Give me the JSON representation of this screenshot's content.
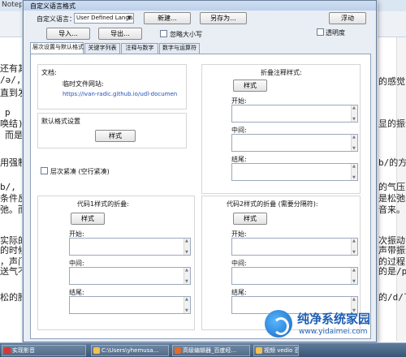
{
  "background": {
    "title": "Notepad",
    "lines_left": [
      "还有其",
      "/ə/,",
      "直到发",
      "p",
      "唤结)",
      "而是",
      "用强制",
      "b/, 就",
      "条件反",
      "弛。而",
      "实际的",
      "的时候",
      "，声门",
      "送气不",
      "松的腾"
    ],
    "lines_right": [
      "的感觉",
      "显的振动",
      "b/的方",
      "的气压",
      "是松弛的",
      "音来。",
      "次振动",
      "声带振动",
      "的过程中",
      "的是/p/",
      "的/d/了"
    ]
  },
  "dialog": {
    "title": "自定义语言格式",
    "language_label": "自定义语言：",
    "language_value": "User Defined Language",
    "new_button": "新建...",
    "save_as_button": "另存为...",
    "dock_button": "浮动",
    "import_button": "导入...",
    "export_button": "导出...",
    "ignore_case_label": "忽略大小写",
    "transparency_label": "透明度",
    "tabs": [
      {
        "label": "层次设置与默认格式"
      },
      {
        "label": "关键字列表"
      },
      {
        "label": "注释与数字"
      },
      {
        "label": "数字与运算符"
      }
    ],
    "doc_label": "文档:",
    "temp_doc_label": "临时文件网站:",
    "doc_url": "https://ivan-radic.github.io/udl-documen",
    "default_style_group": "默认格式设置",
    "style_button": "样式",
    "fold_compact_label": "层次紧凑 (空行紧凑)",
    "fold_comment_group": "折叠注释样式:",
    "open_label": "开始:",
    "middle_label": "中间:",
    "close_label": "结尾:",
    "fold1_group": "代码1样式的折叠:",
    "fold2_group": "代码2样式的折叠 (需要分隔符):"
  },
  "taskbar": {
    "items": [
      {
        "label": "实现影音",
        "color": "#d33"
      },
      {
        "label": "C:\\Users\\yhemusa...",
        "color": "#f2c14e"
      },
      {
        "label": "高级编辑器_百度经...",
        "color": "#e06c2a"
      },
      {
        "label": "视频 vedio 百",
        "color": "#f2c14e"
      }
    ]
  },
  "watermark": {
    "title": "纯净系统家园",
    "url": "www.yidaimei.com"
  }
}
